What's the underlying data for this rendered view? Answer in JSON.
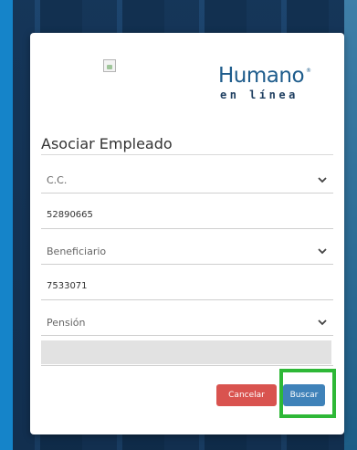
{
  "logo": {
    "main": "Humano",
    "registered": "®",
    "sub": "en línea"
  },
  "modal": {
    "title": "Asociar Empleado"
  },
  "form": {
    "doc_type": {
      "value": "C.C.",
      "icon": "chevron-down-icon"
    },
    "doc_number": {
      "value": "52890665"
    },
    "relation": {
      "value": "Beneficiario",
      "icon": "chevron-down-icon"
    },
    "employee_id": {
      "value": "7533071"
    },
    "category": {
      "value": "Pensión",
      "icon": "chevron-down-icon"
    },
    "extra": {
      "value": ""
    }
  },
  "buttons": {
    "cancel_label": "Cancelar",
    "search_label": "Buscar"
  },
  "colors": {
    "brand": "#1e5c8c",
    "cancel": "#d9534f",
    "search": "#3f82b9",
    "highlight": "#2eb837"
  }
}
